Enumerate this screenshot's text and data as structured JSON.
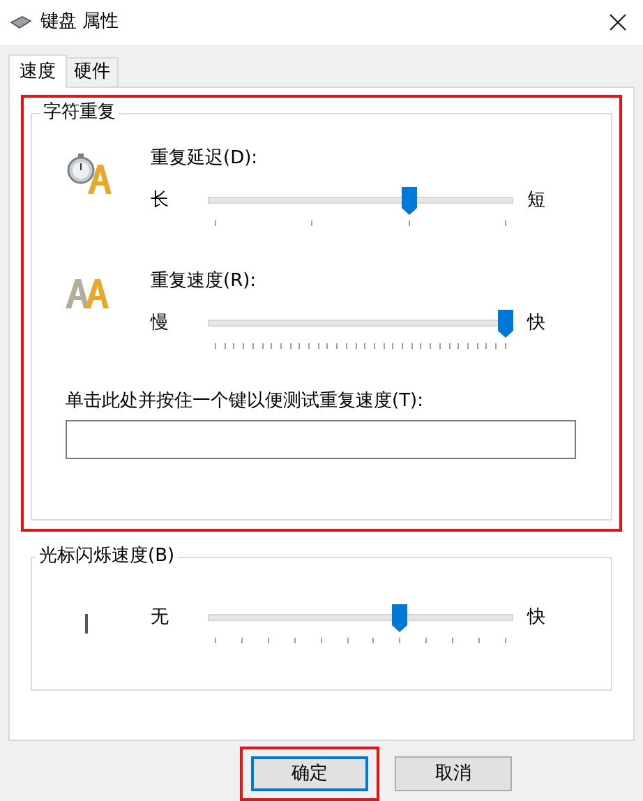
{
  "window": {
    "title": "键盘 属性"
  },
  "tabs": [
    {
      "label": "速度",
      "selected": true
    },
    {
      "label": "硬件",
      "selected": false
    }
  ],
  "character_repeat": {
    "title": "字符重复",
    "highlighted": true,
    "sliders": [
      {
        "label": "重复延迟(D):",
        "min_label": "长",
        "max_label": "短",
        "level": 0.667
      },
      {
        "label": "重复速度(R):",
        "min_label": "慢",
        "max_label": "快",
        "level": 1
      }
    ],
    "test_field": {
      "label": "单击此处并按住一个键以便测试重复速度(T):"
    }
  },
  "cursor_blink": {
    "title": "光标闪烁速度(B)",
    "min_label": "无",
    "max_label": "快",
    "level": 0.636
  },
  "buttons": [
    {
      "label": "确定",
      "highlighted": true,
      "default": true
    },
    {
      "label": "取消",
      "highlighted": false,
      "default": false
    }
  ]
}
